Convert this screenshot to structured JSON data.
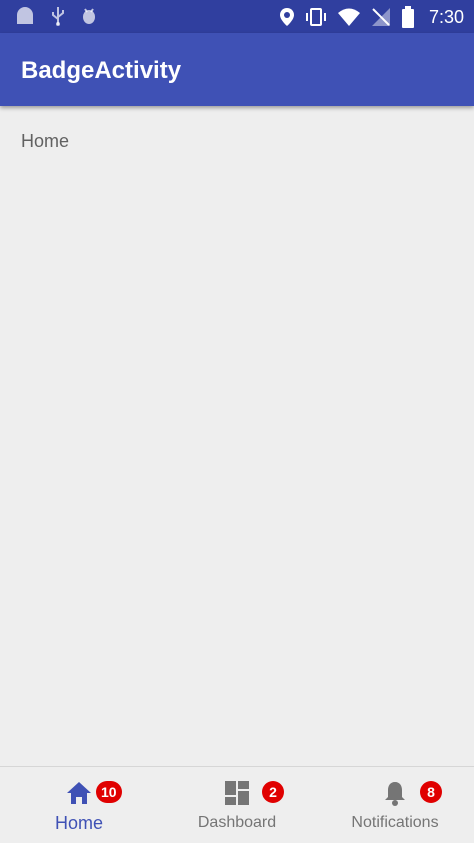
{
  "status_bar": {
    "time": "7:30",
    "left_icons": [
      "android-icon",
      "usb-icon",
      "bug-icon"
    ],
    "right_icons": [
      "location-icon",
      "vibrate-icon",
      "wifi-icon",
      "no-signal-icon",
      "battery-icon"
    ]
  },
  "app_bar": {
    "title": "BadgeActivity"
  },
  "content": {
    "text": "Home"
  },
  "bottom_nav": {
    "items": [
      {
        "label": "Home",
        "icon": "home-icon",
        "badge": "10",
        "active": true
      },
      {
        "label": "Dashboard",
        "icon": "dashboard-icon",
        "badge": "2",
        "active": false
      },
      {
        "label": "Notifications",
        "icon": "bell-icon",
        "badge": "8",
        "active": false
      }
    ]
  },
  "colors": {
    "primary": "#3f51b5",
    "primary_dark": "#303f9f",
    "badge": "#e00000",
    "background": "#eeeeee",
    "inactive": "#757575"
  }
}
